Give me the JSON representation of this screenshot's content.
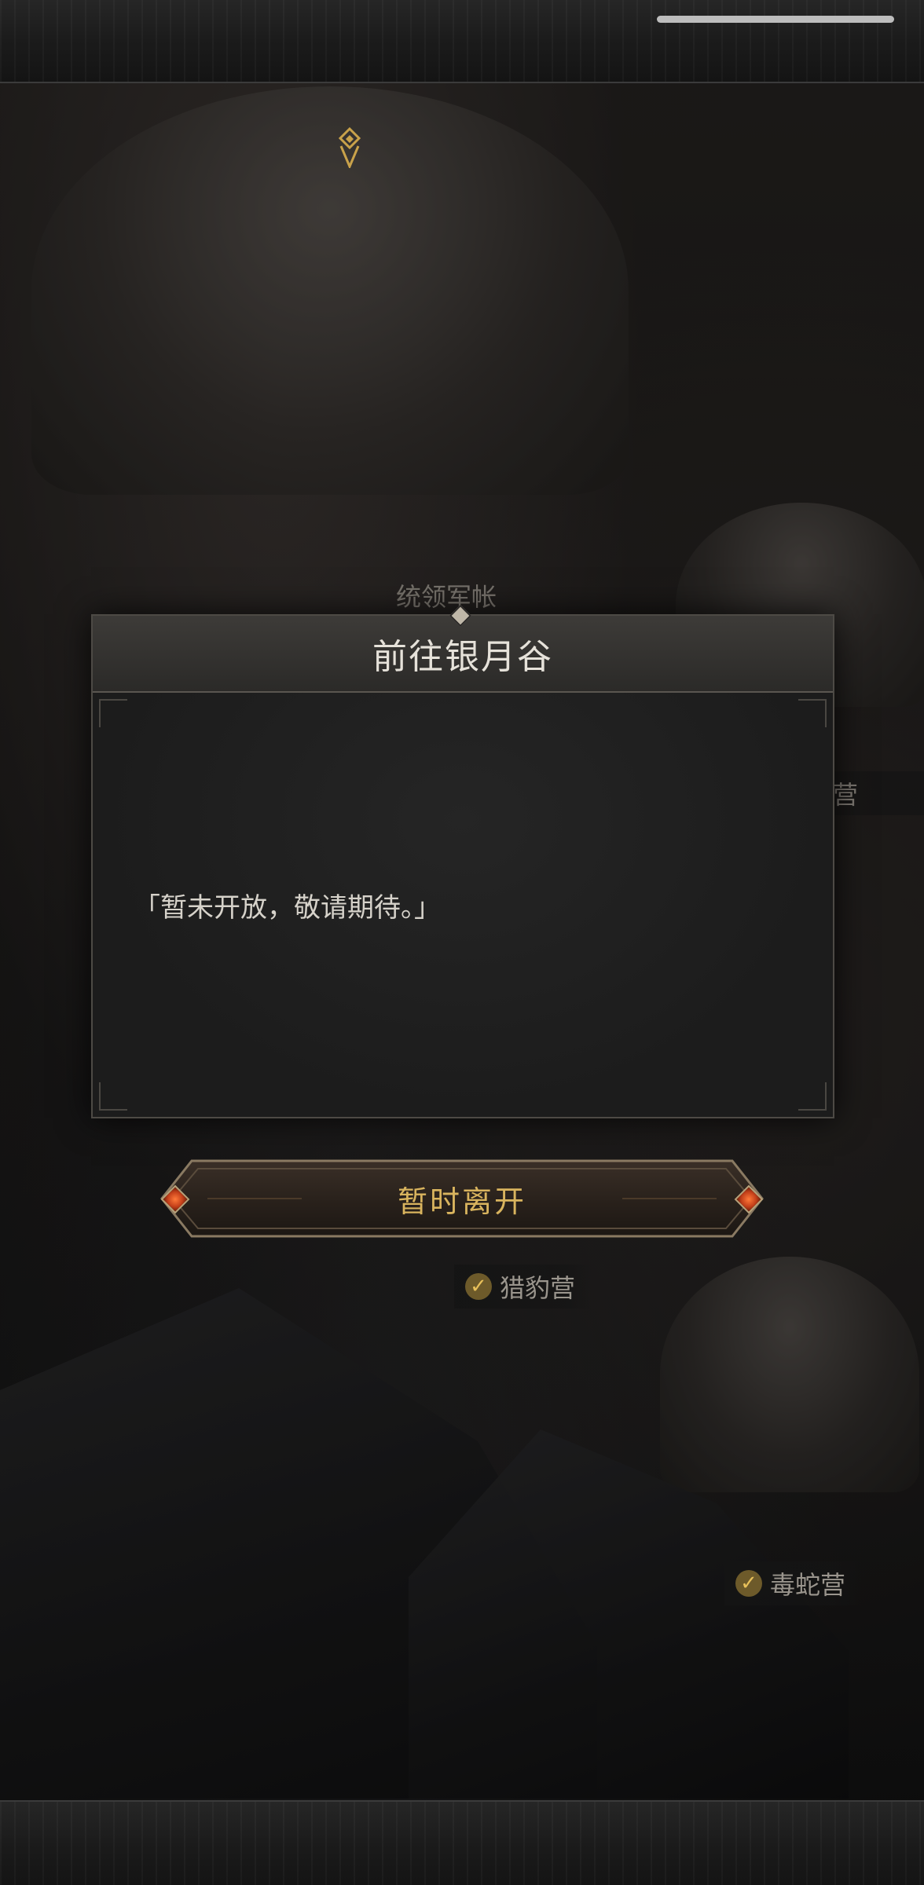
{
  "map": {
    "labels": {
      "commander_tent": "统领军帐",
      "partial_camp": "营",
      "leopard_camp": "猎豹营",
      "viper_camp": "毒蛇营"
    }
  },
  "dialog": {
    "title": "前往银月谷",
    "message": "「暂未开放，敬请期待。」"
  },
  "actions": {
    "leave_label": "暂时离开"
  },
  "colors": {
    "accent_gold": "#d9b45e",
    "gem_orange": "#ff7a3a",
    "marker_gold": "#c9a24a"
  }
}
